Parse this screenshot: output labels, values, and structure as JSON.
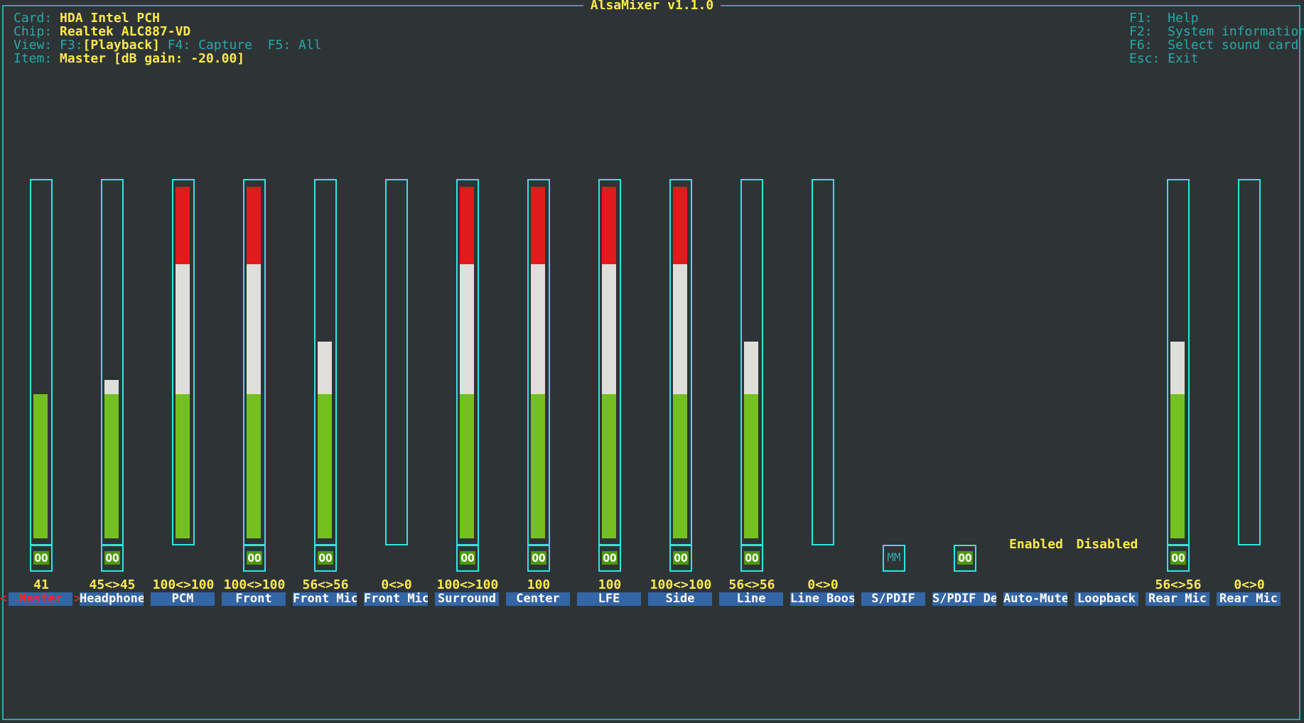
{
  "window": {
    "title": "AlsaMixer v1.1.0"
  },
  "info": {
    "card_label": "Card:",
    "card_value": "HDA Intel PCH",
    "chip_label": "Chip:",
    "chip_value": "Realtek ALC887-VD",
    "view_label": "View:",
    "view_f3": "F3:",
    "view_f3_value": "[Playback]",
    "view_f4": " F4: Capture",
    "view_f5": "  F5: All",
    "item_label": "Item:",
    "item_value": "Master [dB gain: -20.00]"
  },
  "help": {
    "f1": "F1:  Help",
    "f2": "F2:  System information",
    "f6": "F6:  Select sound card",
    "esc": "Esc: Exit"
  },
  "colors": {
    "border": "#2aa7a7",
    "bar_green": "#73c020",
    "bar_white": "#dededb",
    "bar_red": "#e01b1b",
    "name_bg": "#3465a4",
    "value": "#fce94f"
  },
  "channels": [
    {
      "name": "Master",
      "volume": "41",
      "level": 41,
      "mute": "OO",
      "selected": true
    },
    {
      "name": "Headphone",
      "volume": "45<>45",
      "level": 45,
      "mute": "OO"
    },
    {
      "name": "PCM",
      "volume": "100<>100",
      "level": 100
    },
    {
      "name": "Front",
      "volume": "100<>100",
      "level": 100,
      "mute": "OO"
    },
    {
      "name": "Front Mic",
      "volume": "56<>56",
      "level": 56,
      "mute": "OO"
    },
    {
      "name": "Front Mic",
      "volume": "0<>0",
      "level": 0
    },
    {
      "name": "Surround",
      "volume": "100<>100",
      "level": 100,
      "mute": "OO"
    },
    {
      "name": "Center",
      "volume": "100",
      "level": 100,
      "mute": "OO"
    },
    {
      "name": "LFE",
      "volume": "100",
      "level": 100,
      "mute": "OO"
    },
    {
      "name": "Side",
      "volume": "100<>100",
      "level": 100,
      "mute": "OO"
    },
    {
      "name": "Line",
      "volume": "56<>56",
      "level": 56,
      "mute": "OO"
    },
    {
      "name": "Line Boos",
      "volume": "0<>0",
      "level": 0
    },
    {
      "name": "S/PDIF",
      "mute": "MM",
      "muted": true
    },
    {
      "name": "S/PDIF De",
      "mute": "OO"
    },
    {
      "name": "Auto-Mute",
      "enum": "Enabled"
    },
    {
      "name": "Loopback",
      "enum": "Disabled"
    },
    {
      "name": "Rear Mic",
      "volume": "56<>56",
      "level": 56,
      "mute": "OO"
    },
    {
      "name": "Rear Mic",
      "volume": "0<>0",
      "level": 0
    }
  ]
}
